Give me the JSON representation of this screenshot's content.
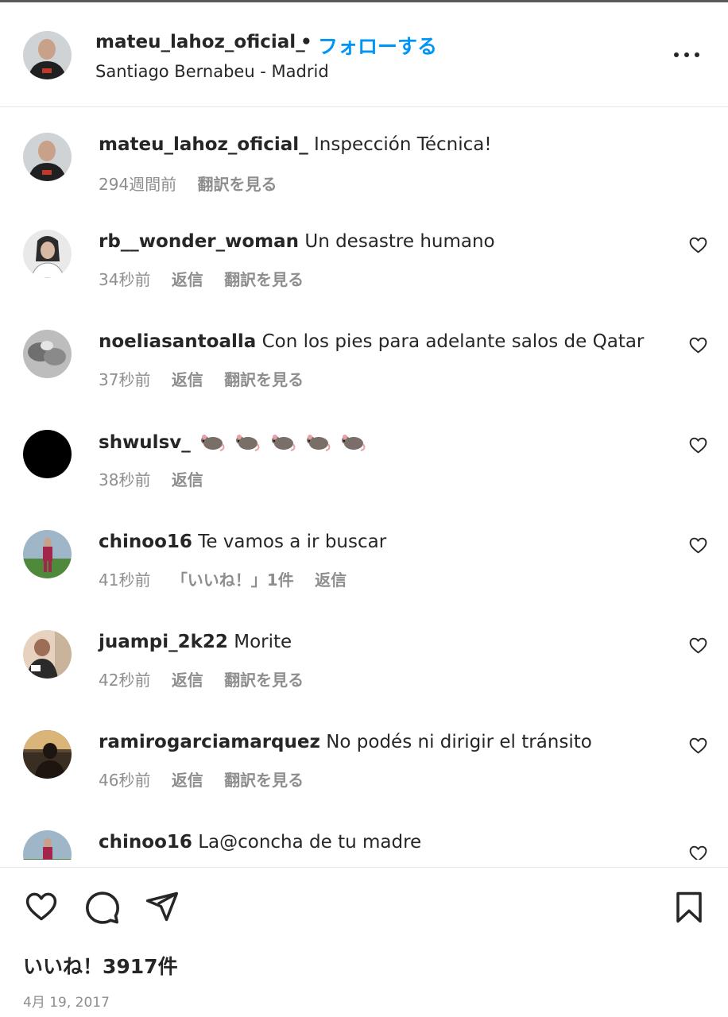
{
  "post": {
    "username": "mateu_lahoz_oficial_",
    "separator": "•",
    "follow_label": "フォローする",
    "location": "Santiago Bernabeu - Madrid",
    "more_icon": "more-horizontal-icon"
  },
  "caption": {
    "username": "mateu_lahoz_oficial_",
    "text": "Inspección Técnica!",
    "time": "294週間前",
    "translate": "翻訳を見る"
  },
  "comments": [
    {
      "username": "rb__wonder_woman",
      "text": "Un desastre humano",
      "time": "34秒前",
      "reply": "返信",
      "translate": "翻訳を見る"
    },
    {
      "username": "noeliasantoalla",
      "text": "Con los pies para adelante salos de Qatar",
      "time": "37秒前",
      "reply": "返信",
      "translate": "翻訳を見る"
    },
    {
      "username": "shwulsv_",
      "text": "🐀🐀🐀🐀🐀",
      "time": "38秒前",
      "reply": "返信"
    },
    {
      "username": "chinoo16",
      "text": "Te vamos a ir buscar",
      "time": "41秒前",
      "likes": "「いいね！」1件",
      "reply": "返信"
    },
    {
      "username": "juampi_2k22",
      "text": "Morite",
      "time": "42秒前",
      "reply": "返信",
      "translate": "翻訳を見る"
    },
    {
      "username": "ramirogarciamarquez",
      "text": "No podés ni dirigir el tránsito",
      "time": "46秒前",
      "reply": "返信",
      "translate": "翻訳を見る"
    },
    {
      "username": "chinoo16",
      "text": "La@concha de tu madre"
    }
  ],
  "footer": {
    "likes": "いいね！3917件",
    "date": "4月 19, 2017"
  },
  "colors": {
    "accent": "#0095f6",
    "text": "#262626",
    "secondary": "#8e8e8e"
  }
}
